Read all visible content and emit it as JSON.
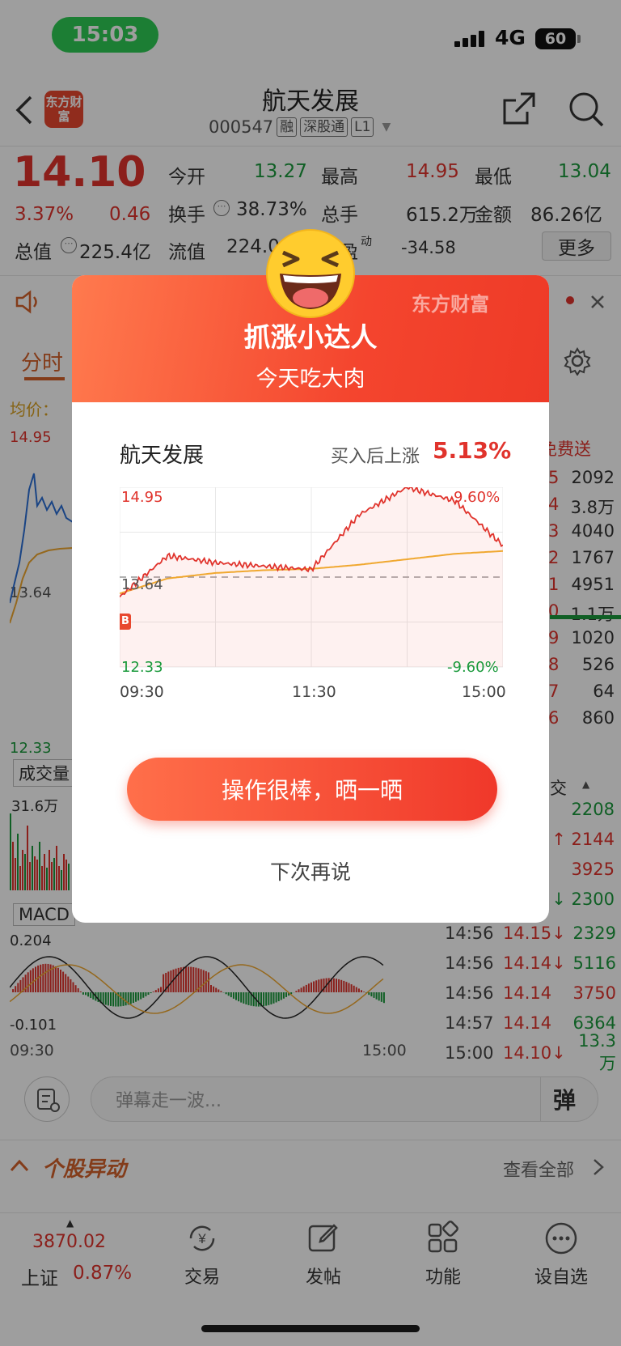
{
  "status_bar": {
    "time": "15:03",
    "network": "4G",
    "battery": "60"
  },
  "header": {
    "title": "航天发展",
    "code": "000547",
    "tags": [
      "融",
      "深股通",
      "L1"
    ],
    "logo_text": "东方财富"
  },
  "quote": {
    "price": "14.10",
    "change_pct": "3.37%",
    "change": "0.46",
    "open_label": "今开",
    "open": "13.27",
    "high_label": "最高",
    "high": "14.95",
    "low_label": "最低",
    "low": "13.04",
    "turnover_label": "换手",
    "turnover": "38.73%",
    "volume_label": "总手",
    "volume": "615.2万",
    "amount_label": "金额",
    "amount": "86.26亿",
    "mktcap_label": "总值",
    "mktcap": "225.4亿",
    "float_label": "流值",
    "float": "224.0",
    "pe_label": "盈",
    "pe_sup": "动",
    "pe": "-34.58",
    "more": "更多"
  },
  "chart_tabs": {
    "active": "分时",
    "avg_label": "均价："
  },
  "left_chart": {
    "high": "14.95",
    "mid": "13.64",
    "low": "12.33",
    "vol_tab": "成交量",
    "vol_max": "31.6万",
    "macd_tab": "MACD",
    "macd_hi": "0.204",
    "macd_lo": "-0.101",
    "t_start": "09:30",
    "t_end": "15:00"
  },
  "right_panel": {
    "promo": "免费送",
    "book": [
      [
        "5",
        "2092"
      ],
      [
        "4",
        "3.8万"
      ],
      [
        "3",
        "4040"
      ],
      [
        "2",
        "1767"
      ],
      [
        "1",
        "4951"
      ],
      [
        "0",
        "1.1万"
      ],
      [
        "9",
        "1020"
      ],
      [
        "8",
        "526"
      ],
      [
        "7",
        "64"
      ],
      [
        "6",
        "860"
      ]
    ],
    "ticks_header": "交",
    "ticks_partial": [
      [
        "2208",
        "green"
      ],
      [
        "↑ 2144",
        "red"
      ],
      [
        "3925",
        "red"
      ],
      [
        "↓ 2300",
        "green"
      ]
    ],
    "ticks": [
      {
        "t": "14:56",
        "p": "14.15",
        "d": "↓",
        "v": "2329",
        "vc": "green"
      },
      {
        "t": "14:56",
        "p": "14.14",
        "d": "↓",
        "v": "5116",
        "vc": "green"
      },
      {
        "t": "14:56",
        "p": "14.14",
        "d": "",
        "v": "3750",
        "vc": "red"
      },
      {
        "t": "14:57",
        "p": "14.14",
        "d": "",
        "v": "6364",
        "vc": "green"
      },
      {
        "t": "15:00",
        "p": "14.10",
        "d": "↓",
        "v": "13.3万",
        "vc": "green"
      }
    ]
  },
  "barrage": {
    "placeholder": "弹幕走一波...",
    "button": "弹"
  },
  "section": {
    "title": "个股异动",
    "link": "查看全部"
  },
  "tabbar": {
    "index_value": "3870.02",
    "index_name": "上证",
    "index_change": "0.87%",
    "trade": "交易",
    "post": "发帖",
    "func": "功能",
    "watch": "设自选"
  },
  "modal": {
    "brand": "东方财富",
    "title": "抓涨小达人",
    "subtitle": "今天吃大肉",
    "stock": "航天发展",
    "gain_label": "买入后上涨",
    "gain": "5.13%",
    "chart_high": "14.95",
    "chart_mid": "13.64",
    "chart_low": "12.33",
    "pct_high": "9.60%",
    "pct_low": "-9.60%",
    "times": [
      "09:30",
      "11:30",
      "15:00"
    ],
    "share_button": "操作很棒，晒一晒",
    "later": "下次再说",
    "buy_marker": "B"
  },
  "chart_data": {
    "type": "line",
    "title": "航天发展",
    "x": [
      "09:30",
      "10:00",
      "10:30",
      "11:00",
      "11:30",
      "13:30",
      "14:00",
      "14:30",
      "15:00"
    ],
    "series": [
      {
        "name": "",
        "values": [
          13.35,
          13.95,
          13.85,
          13.8,
          13.75,
          14.55,
          14.95,
          14.75,
          14.1
        ]
      },
      {
        "name": "均价",
        "values": [
          13.4,
          13.62,
          13.7,
          13.74,
          13.76,
          13.82,
          13.9,
          13.98,
          14.02
        ]
      }
    ],
    "ylim": [
      12.33,
      14.95
    ],
    "colors": {
      "price": "#e0332c",
      "avg": "#f0a830"
    }
  }
}
